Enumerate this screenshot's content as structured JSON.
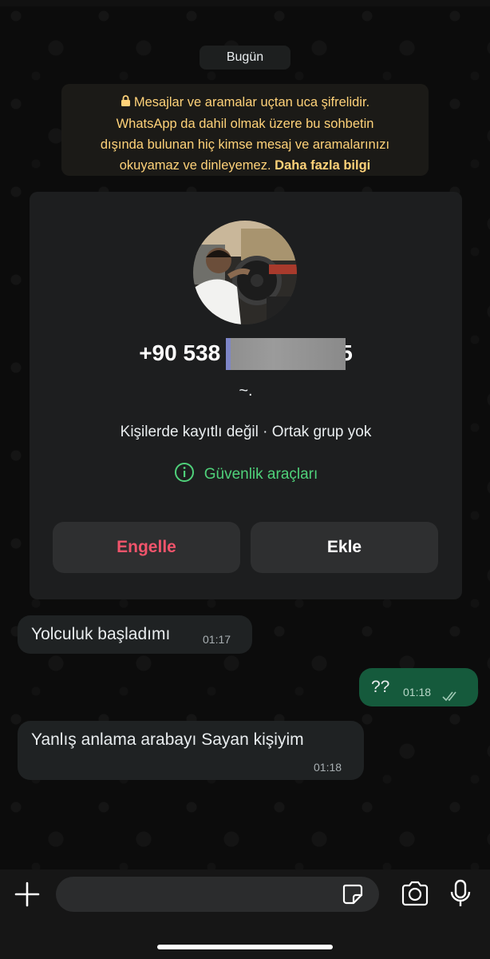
{
  "date_chip": "Bugün",
  "encryption": {
    "line1": "Mesajlar ve aramalar uçtan uca şifrelidir.",
    "line2": "WhatsApp da dahil olmak üzere bu sohbetin",
    "line3": "dışında bulunan hiç kimse mesaj ve aramalarınızı",
    "line4": "okuyamaz ve dinleyemez.",
    "link": "Daha fazla bilgi"
  },
  "contact": {
    "phone": "+90 538",
    "phone_tail": "5",
    "about": "~.",
    "meta": "Kişilerde kayıtlı değil · Ortak grup yok",
    "security_tools": "Güvenlik araçları",
    "block_label": "Engelle",
    "add_label": "Ekle"
  },
  "messages": [
    {
      "direction": "incoming",
      "text": "Yolculuk başladımı",
      "time": "01:17"
    },
    {
      "direction": "outgoing",
      "text": "??",
      "time": "01:18",
      "status": "read"
    },
    {
      "direction": "incoming",
      "text": "Yanlış anlama arabayı Sayan kişiyim",
      "time": "01:18"
    }
  ],
  "composer": {
    "icons": [
      "plus-icon",
      "sticker-icon",
      "camera-icon",
      "microphone-icon"
    ]
  },
  "colors": {
    "accent_green": "#4fd17a",
    "outgoing_bubble": "#155a3c",
    "block_red": "#f1546b",
    "notice_yellow": "#ffd279"
  }
}
